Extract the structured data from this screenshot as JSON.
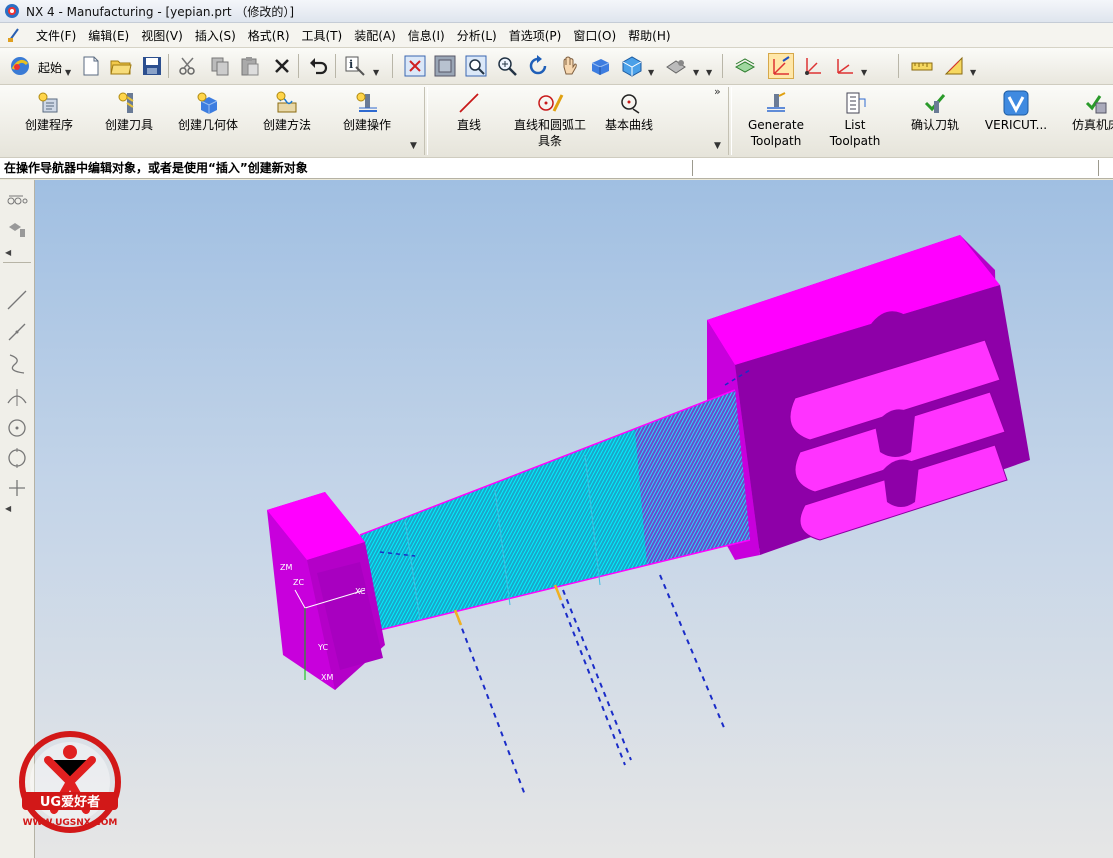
{
  "window": {
    "title": "NX 4 - Manufacturing - [yepian.prt （修改的）]"
  },
  "menu": [
    "文件(F)",
    "编辑(E)",
    "视图(V)",
    "插入(S)",
    "格式(R)",
    "工具(T)",
    "装配(A)",
    "信息(I)",
    "分析(L)",
    "首选项(P)",
    "窗口(O)",
    "帮助(H)"
  ],
  "toolbar": {
    "start_label": "起始"
  },
  "ops_toolbar": {
    "create_program": "创建程序",
    "create_tool": "创建刀具",
    "create_geometry": "创建几何体",
    "create_method": "创建方法",
    "create_operation": "创建操作"
  },
  "curve_toolbar": {
    "line": "直线",
    "line_arc_1": "直线和圆弧工",
    "line_arc_2": "具条",
    "basic_curves": "基本曲线"
  },
  "toolpath_toolbar": {
    "generate_1": "Generate",
    "generate_2": "Toolpath",
    "list_1": "List",
    "list_2": "Toolpath",
    "verify": "确认刀轨",
    "vericut": "VERICUT...",
    "simulate": "仿真机床"
  },
  "status": {
    "message": "在操作导航器中编辑对象，或者是使用“插入”创建新对象"
  },
  "viewport": {
    "axis_zm": "ZM",
    "axis_zc": "ZC",
    "axis_yc": "YC",
    "axis_xc": "XC",
    "axis_xm": "XM"
  },
  "watermark": {
    "brand": "UG爱好者",
    "url": "WWW.UGSNX.COM"
  },
  "colors": {
    "part": "#ff00ff",
    "part_dark": "#a000b0",
    "toolpath": "#00e5ff",
    "rapid": "#1a2cc8",
    "engage": "#f0b020"
  }
}
